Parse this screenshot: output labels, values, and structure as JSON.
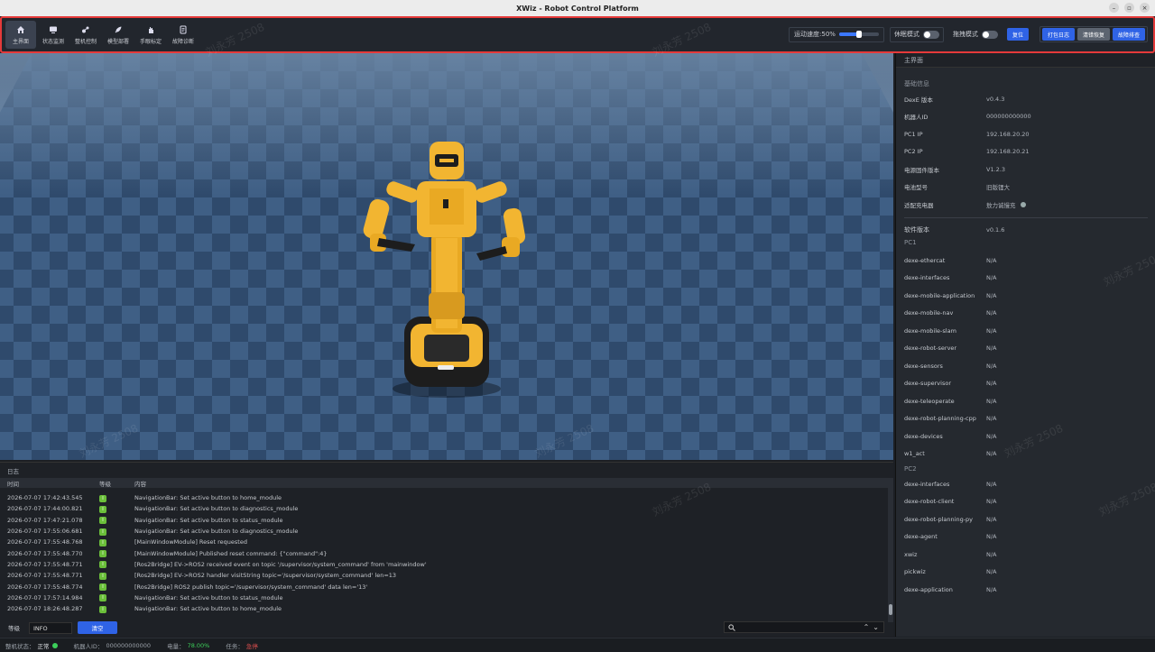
{
  "window": {
    "title": "XWiz - Robot Control Platform"
  },
  "nav": {
    "items": [
      {
        "label": "主界面",
        "icon": "home-icon",
        "active": true
      },
      {
        "label": "状态监测",
        "icon": "monitor-icon",
        "active": false
      },
      {
        "label": "整机控制",
        "icon": "robot-control-icon",
        "active": false
      },
      {
        "label": "模型部署",
        "icon": "rocket-icon",
        "active": false
      },
      {
        "label": "手眼标定",
        "icon": "hand-icon",
        "active": false
      },
      {
        "label": "故障诊断",
        "icon": "diagnostics-icon",
        "active": false
      }
    ]
  },
  "toolbar": {
    "speed_label": "运动速度:50%",
    "speed_value": 0.5,
    "sleep_mode_label": "休眠模式",
    "sleep_mode_on": false,
    "drag_mode_label": "拖拽模式",
    "drag_mode_on": false,
    "reset_label": "复位",
    "pack_log_label": "打包日志",
    "clear_error_label": "清错恢复",
    "fault_report_label": "故障排查"
  },
  "right_panel": {
    "header": "主界面",
    "basic_info_title": "基础信息",
    "basic_info": [
      {
        "key": "DexE 版本",
        "value": "v0.4.3"
      },
      {
        "key": "机器人ID",
        "value": "000000000000"
      },
      {
        "key": "PC1 IP",
        "value": "192.168.20.20"
      },
      {
        "key": "PC2 IP",
        "value": "192.168.20.21"
      },
      {
        "key": "电源固件版本",
        "value": "V1.2.3"
      },
      {
        "key": "电池型号",
        "value": "旧版锂大"
      },
      {
        "key": "适配充电器",
        "value": "敖力诚慢充"
      }
    ],
    "software_version_label": "软件版本",
    "software_version_value": "v0.1.6",
    "pc1_title": "PC1",
    "pc1_items": [
      {
        "key": "dexe-ethercat",
        "value": "N/A"
      },
      {
        "key": "dexe-interfaces",
        "value": "N/A"
      },
      {
        "key": "dexe-mobile-application",
        "value": "N/A"
      },
      {
        "key": "dexe-mobile-nav",
        "value": "N/A"
      },
      {
        "key": "dexe-mobile-slam",
        "value": "N/A"
      },
      {
        "key": "dexe-robot-server",
        "value": "N/A"
      },
      {
        "key": "dexe-sensors",
        "value": "N/A"
      },
      {
        "key": "dexe-supervisor",
        "value": "N/A"
      },
      {
        "key": "dexe-teleoperate",
        "value": "N/A"
      },
      {
        "key": "dexe-robot-planning-cpp",
        "value": "N/A"
      },
      {
        "key": "dexe-devices",
        "value": "N/A"
      },
      {
        "key": "w1_act",
        "value": "N/A"
      }
    ],
    "pc2_title": "PC2",
    "pc2_items": [
      {
        "key": "dexe-interfaces",
        "value": "N/A"
      },
      {
        "key": "dexe-robot-client",
        "value": "N/A"
      },
      {
        "key": "dexe-robot-planning-py",
        "value": "N/A"
      },
      {
        "key": "dexe-agent",
        "value": "N/A"
      },
      {
        "key": "xwiz",
        "value": "N/A"
      },
      {
        "key": "pickwiz",
        "value": "N/A"
      },
      {
        "key": "dexe-application",
        "value": "N/A"
      }
    ]
  },
  "log": {
    "title": "日志",
    "columns": [
      "时间",
      "等级",
      "内容"
    ],
    "rows": [
      {
        "time": "2026-07-07 17:42:43.545",
        "level": "I",
        "message": "NavigationBar: Set active button to home_module"
      },
      {
        "time": "2026-07-07 17:44:00.821",
        "level": "I",
        "message": "NavigationBar: Set active button to diagnostics_module"
      },
      {
        "time": "2026-07-07 17:47:21.078",
        "level": "I",
        "message": "NavigationBar: Set active button to status_module"
      },
      {
        "time": "2026-07-07 17:55:06.681",
        "level": "I",
        "message": "NavigationBar: Set active button to diagnostics_module"
      },
      {
        "time": "2026-07-07 17:55:48.768",
        "level": "I",
        "message": "[MainWindowModule] Reset requested"
      },
      {
        "time": "2026-07-07 17:55:48.770",
        "level": "I",
        "message": "[MainWindowModule] Published reset command: {\"command\":4}"
      },
      {
        "time": "2026-07-07 17:55:48.771",
        "level": "I",
        "message": "[Ros2Bridge] EV->ROS2 received event on topic '/supervisor/system_command' from 'mainwindow'"
      },
      {
        "time": "2026-07-07 17:55:48.771",
        "level": "I",
        "message": "[Ros2Bridge] EV->ROS2 handler visitString topic='/supervisor/system_command' len=13"
      },
      {
        "time": "2026-07-07 17:55:48.774",
        "level": "I",
        "message": "[Ros2Bridge] ROS2 publish topic='/supervisor/system_command' data len='13'"
      },
      {
        "time": "2026-07-07 17:57:14.984",
        "level": "I",
        "message": "NavigationBar: Set active button to status_module"
      },
      {
        "time": "2026-07-07 18:26:48.287",
        "level": "I",
        "message": "NavigationBar: Set active button to home_module"
      }
    ],
    "level_label": "等级",
    "level_value": "INFO",
    "clear_label": "清空",
    "search_placeholder": ""
  },
  "status_bar": {
    "machine_status_label": "整机状态：",
    "machine_status_value": "正常",
    "robot_id_label": "机器人ID：",
    "robot_id_value": "000000000000",
    "battery_label": "电量：",
    "battery_value": "78.00%",
    "task_label": "任务：",
    "task_value": "急停"
  },
  "watermark": "刘永芳 2508",
  "colors": {
    "accent": "#2f63e6",
    "highlight_border": "#e53a3a",
    "robot_yellow": "#f2b531",
    "ok_green": "#3ccf5a",
    "alert_red": "#e25050"
  }
}
